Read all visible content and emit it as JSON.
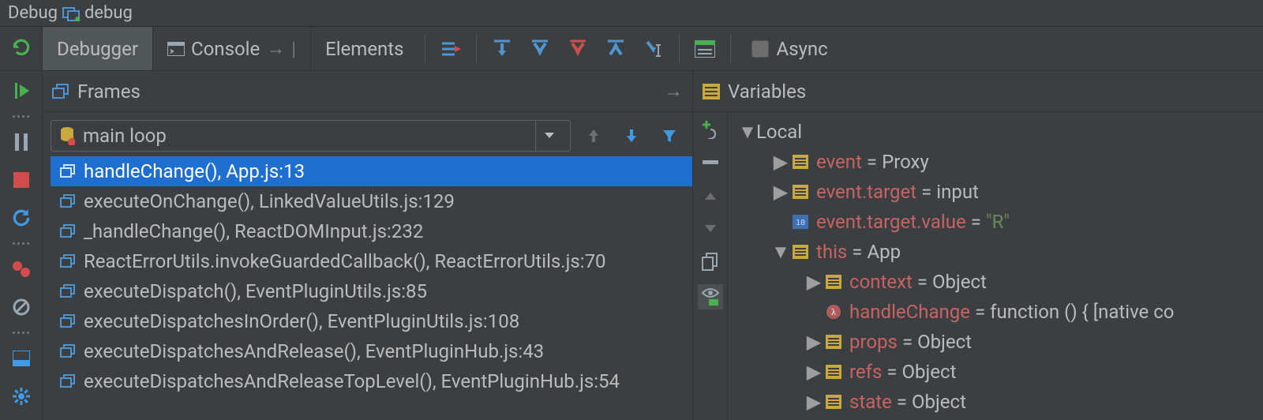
{
  "title": {
    "tool_window": "Debug",
    "config": "debug"
  },
  "tabs": {
    "debugger": "Debugger",
    "console": "Console",
    "elements": "Elements"
  },
  "toolbar": {
    "async_label": "Async"
  },
  "frames_panel": {
    "title": "Frames",
    "thread": "main loop"
  },
  "frames": [
    {
      "label": "handleChange(), App.js:13",
      "selected": true
    },
    {
      "label": "executeOnChange(), LinkedValueUtils.js:129",
      "selected": false
    },
    {
      "label": "_handleChange(), ReactDOMInput.js:232",
      "selected": false
    },
    {
      "label": "ReactErrorUtils.invokeGuardedCallback(), ReactErrorUtils.js:70",
      "selected": false
    },
    {
      "label": "executeDispatch(), EventPluginUtils.js:85",
      "selected": false
    },
    {
      "label": "executeDispatchesInOrder(), EventPluginUtils.js:108",
      "selected": false
    },
    {
      "label": "executeDispatchesAndRelease(), EventPluginHub.js:43",
      "selected": false
    },
    {
      "label": "executeDispatchesAndReleaseTopLevel(), EventPluginHub.js:54",
      "selected": false
    }
  ],
  "vars_panel": {
    "title": "Variables"
  },
  "vars": {
    "scope": "Local",
    "rows": [
      {
        "depth": 1,
        "exp": "▶",
        "icon": "obj",
        "name": "event",
        "val": "Proxy",
        "val_kind": "plain"
      },
      {
        "depth": 1,
        "exp": "▶",
        "icon": "obj",
        "name": "event.target",
        "val": "input",
        "val_kind": "plain"
      },
      {
        "depth": 1,
        "exp": "",
        "icon": "prim",
        "name": "event.target.value",
        "val": "\"R\"",
        "val_kind": "str"
      },
      {
        "depth": 1,
        "exp": "▼",
        "icon": "obj",
        "name": "this",
        "val": "App",
        "val_kind": "plain"
      },
      {
        "depth": 2,
        "exp": "▶",
        "icon": "obj",
        "name": "context",
        "val": "Object",
        "val_kind": "plain"
      },
      {
        "depth": 2,
        "exp": "",
        "icon": "lambda",
        "name": "handleChange",
        "val": "function () { [native co",
        "val_kind": "plain"
      },
      {
        "depth": 2,
        "exp": "▶",
        "icon": "obj",
        "name": "props",
        "val": "Object",
        "val_kind": "plain"
      },
      {
        "depth": 2,
        "exp": "▶",
        "icon": "obj",
        "name": "refs",
        "val": "Object",
        "val_kind": "plain"
      },
      {
        "depth": 2,
        "exp": "▶",
        "icon": "obj",
        "name": "state",
        "val": "Object",
        "val_kind": "plain"
      }
    ]
  }
}
